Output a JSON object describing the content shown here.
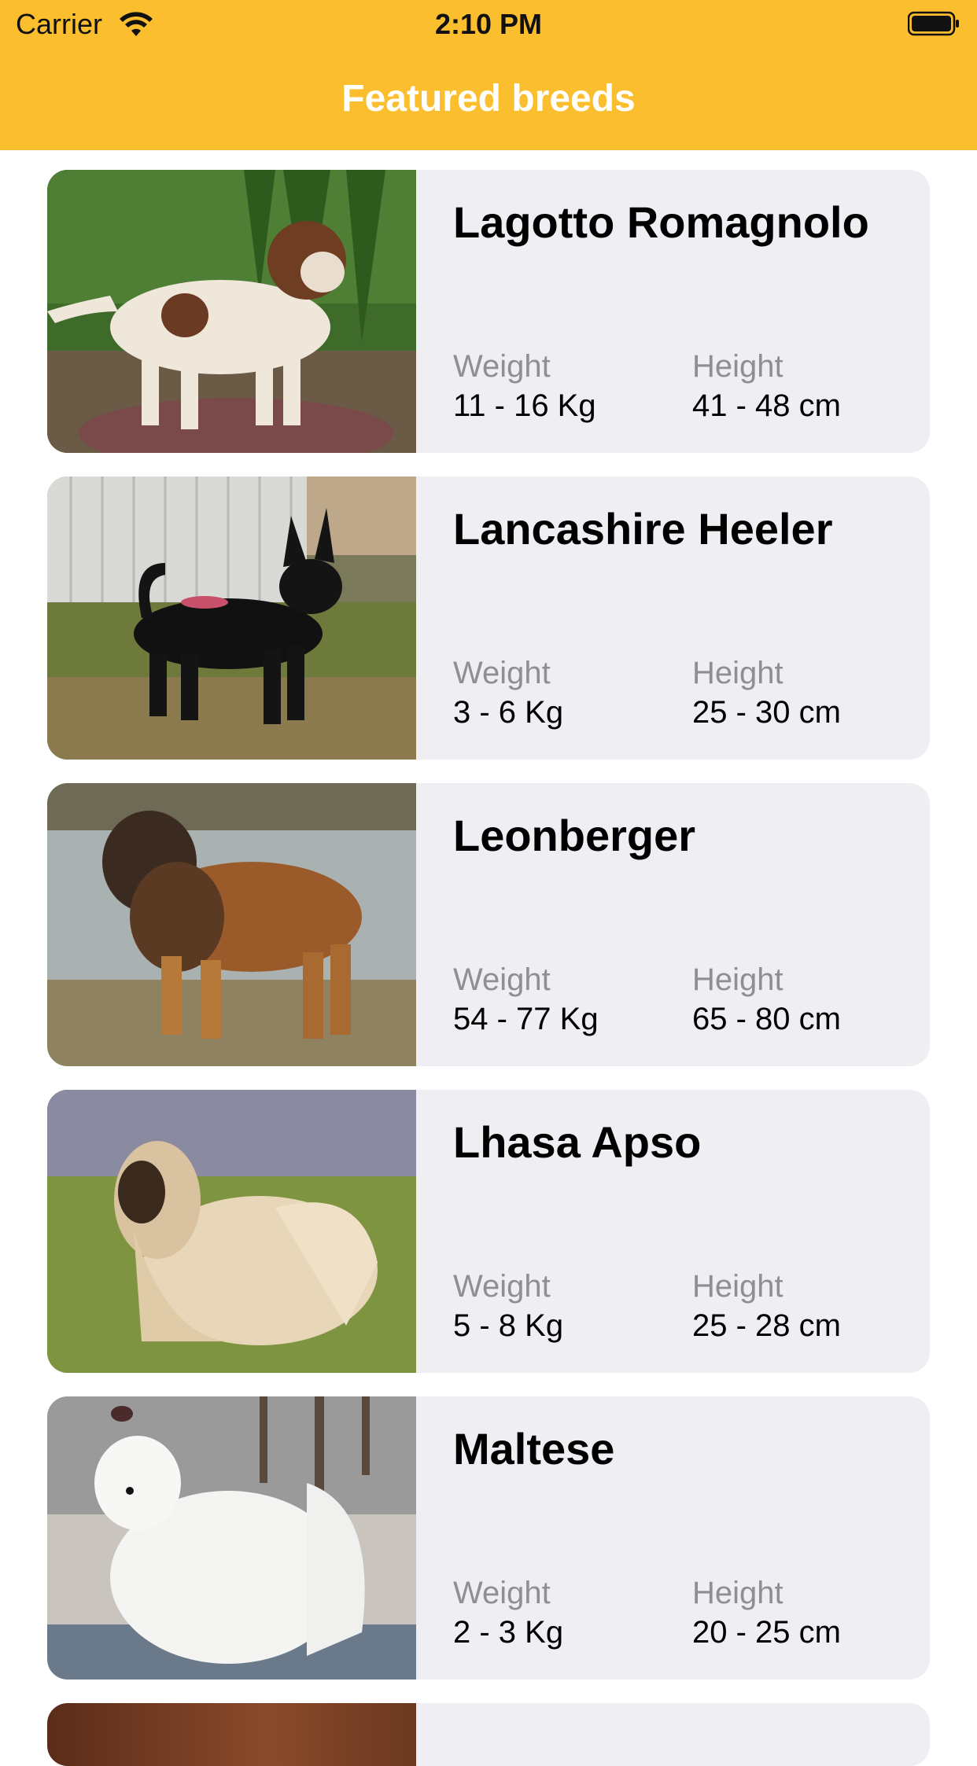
{
  "status_bar": {
    "carrier": "Carrier",
    "time": "2:10 PM"
  },
  "nav": {
    "title": "Featured breeds"
  },
  "labels": {
    "weight": "Weight",
    "height": "Height"
  },
  "breeds": [
    {
      "name": "Lagotto Romagnolo",
      "weight": "11 - 16 Kg",
      "height": "41 - 48 cm"
    },
    {
      "name": "Lancashire Heeler",
      "weight": "3 - 6 Kg",
      "height": "25 - 30 cm"
    },
    {
      "name": "Leonberger",
      "weight": "54 - 77 Kg",
      "height": "65 - 80 cm"
    },
    {
      "name": "Lhasa Apso",
      "weight": "5 - 8 Kg",
      "height": "25 - 28 cm"
    },
    {
      "name": "Maltese",
      "weight": "2 - 3 Kg",
      "height": "20 - 25 cm"
    }
  ],
  "colors": {
    "accent": "#FBBE2E",
    "card_background": "#EEEEF3",
    "secondary_text": "#8e8e93"
  }
}
